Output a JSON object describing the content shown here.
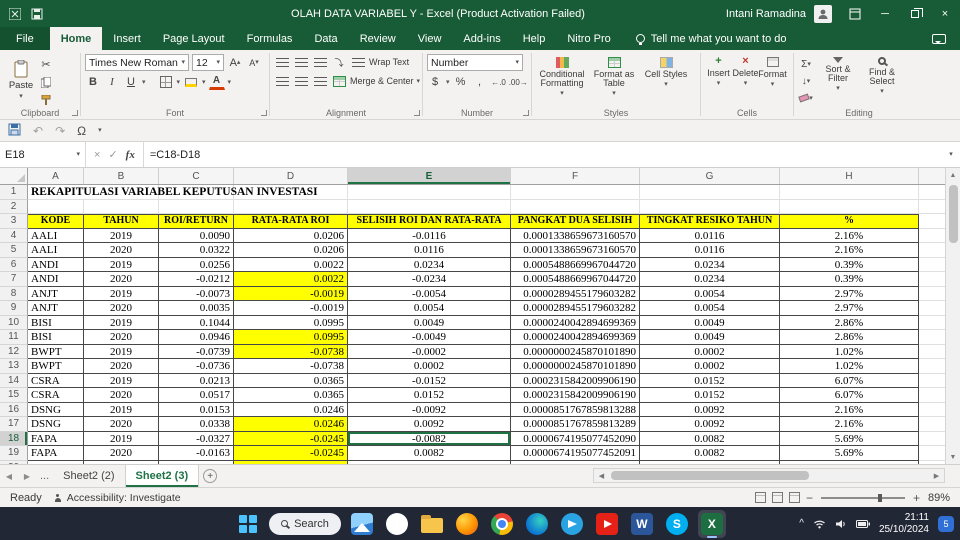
{
  "titlebar": {
    "title": "OLAH DATA VARIABEL Y - Excel (Product Activation Failed)",
    "user": "Intani Ramadina"
  },
  "tabbar": {
    "file": "File",
    "tabs": [
      "Home",
      "Insert",
      "Page Layout",
      "Formulas",
      "Data",
      "Review",
      "View",
      "Add-ins",
      "Help",
      "Nitro Pro"
    ],
    "active": "Home",
    "tellme": "Tell me what you want to do"
  },
  "ribbon": {
    "groups": [
      "Clipboard",
      "Font",
      "Alignment",
      "Number",
      "Styles",
      "Cells",
      "Editing"
    ],
    "paste": "Paste",
    "font_name": "Times New Roman",
    "font_size": "12",
    "wrap_text": "Wrap Text",
    "merge_center": "Merge & Center",
    "number_format": "Number",
    "conditional": "Conditional Formatting",
    "format_table": "Format as Table",
    "cell_styles": "Cell Styles",
    "insert": "Insert",
    "delete": "Delete",
    "format": "Format",
    "sort_filter": "Sort & Filter",
    "find_select": "Find & Select"
  },
  "icons": {
    "caret": "▾",
    "undo": "↶",
    "redo": "↷",
    "omega": "Ω",
    "sigma": "Σ",
    "bold": "B",
    "italic": "I",
    "underline": "U",
    "grow_font": "A",
    "shrink_font": "A",
    "font_color_a": "A",
    "dollar": "$",
    "percent": "%",
    "comma": ",",
    "inc_decimal": "←.0",
    "dec_decimal": ".00→",
    "cancel": "×",
    "check": "✓",
    "fx": "fx",
    "fill_down": "↓",
    "minimize": "─",
    "close": "×",
    "chevron_up": "^",
    "prev": "◀",
    "next": "▶",
    "add": "+",
    "minus": "−",
    "plus": "+",
    "scroll_up": "▲",
    "scroll_down": "▼",
    "word_w": "W",
    "skype_s": "S",
    "excel_x": "X"
  },
  "formulabar": {
    "name_box": "E18",
    "formula": "=C18-D18"
  },
  "sheet": {
    "title": "REKAPITULASI VARIABEL KEPUTUSAN INVESTASI",
    "columns": [
      "A",
      "B",
      "C",
      "D",
      "E",
      "F",
      "G",
      "H"
    ],
    "headers": [
      "KODE",
      "TAHUN",
      "ROI/RETURN",
      "RATA-RATA ROI",
      "SELISIH ROI DAN RATA-RATA",
      "PANGKAT DUA SELISIH",
      "TINGKAT RESIKO TAHUN",
      "%"
    ],
    "active": {
      "row": 18,
      "col": "E"
    },
    "rows": [
      {
        "n": 4,
        "c": [
          "AALI",
          "2019",
          "0.0090",
          "0.0206",
          "-0.0116",
          "0.0001338659673160570",
          "0.0116",
          "2.16%"
        ],
        "y": false
      },
      {
        "n": 5,
        "c": [
          "AALI",
          "2020",
          "0.0322",
          "0.0206",
          "0.0116",
          "0.0001338659673160570",
          "0.0116",
          "2.16%"
        ],
        "y": false
      },
      {
        "n": 6,
        "c": [
          "ANDI",
          "2019",
          "0.0256",
          "0.0022",
          "0.0234",
          "0.0005488669967044720",
          "0.0234",
          "0.39%"
        ],
        "y": false
      },
      {
        "n": 7,
        "c": [
          "ANDI",
          "2020",
          "-0.0212",
          "0.0022",
          "-0.0234",
          "0.0005488669967044720",
          "0.0234",
          "0.39%"
        ],
        "y": true
      },
      {
        "n": 8,
        "c": [
          "ANJT",
          "2019",
          "-0.0073",
          "-0.0019",
          "-0.0054",
          "0.0000289455179603282",
          "0.0054",
          "2.97%"
        ],
        "y": true
      },
      {
        "n": 9,
        "c": [
          "ANJT",
          "2020",
          "0.0035",
          "-0.0019",
          "0.0054",
          "0.0000289455179603282",
          "0.0054",
          "2.97%"
        ],
        "y": false
      },
      {
        "n": 10,
        "c": [
          "BISI",
          "2019",
          "0.1044",
          "0.0995",
          "0.0049",
          "0.0000240042894699369",
          "0.0049",
          "2.86%"
        ],
        "y": false
      },
      {
        "n": 11,
        "c": [
          "BISI",
          "2020",
          "0.0946",
          "0.0995",
          "-0.0049",
          "0.0000240042894699369",
          "0.0049",
          "2.86%"
        ],
        "y": true
      },
      {
        "n": 12,
        "c": [
          "BWPT",
          "2019",
          "-0.0739",
          "-0.0738",
          "-0.0002",
          "0.0000000245870101890",
          "0.0002",
          "1.02%"
        ],
        "y": true
      },
      {
        "n": 13,
        "c": [
          "BWPT",
          "2020",
          "-0.0736",
          "-0.0738",
          "0.0002",
          "0.0000000245870101890",
          "0.0002",
          "1.02%"
        ],
        "y": false
      },
      {
        "n": 14,
        "c": [
          "CSRA",
          "2019",
          "0.0213",
          "0.0365",
          "-0.0152",
          "0.0002315842009906190",
          "0.0152",
          "6.07%"
        ],
        "y": false
      },
      {
        "n": 15,
        "c": [
          "CSRA",
          "2020",
          "0.0517",
          "0.0365",
          "0.0152",
          "0.0002315842009906190",
          "0.0152",
          "6.07%"
        ],
        "y": false
      },
      {
        "n": 16,
        "c": [
          "DSNG",
          "2019",
          "0.0153",
          "0.0246",
          "-0.0092",
          "0.0000851767859813288",
          "0.0092",
          "2.16%"
        ],
        "y": false
      },
      {
        "n": 17,
        "c": [
          "DSNG",
          "2020",
          "0.0338",
          "0.0246",
          "0.0092",
          "0.0000851767859813289",
          "0.0092",
          "2.16%"
        ],
        "y": true
      },
      {
        "n": 18,
        "c": [
          "FAPA",
          "2019",
          "-0.0327",
          "-0.0245",
          "-0.0082",
          "0.0000674195077452090",
          "0.0082",
          "5.69%"
        ],
        "y": true
      },
      {
        "n": 19,
        "c": [
          "FAPA",
          "2020",
          "-0.0163",
          "-0.0245",
          "0.0082",
          "0.0000674195077452091",
          "0.0082",
          "5.69%"
        ],
        "y": true
      }
    ]
  },
  "sheettabs": {
    "ellipsis": "...",
    "tabs": [
      "Sheet2 (2)",
      "Sheet2 (3)"
    ],
    "active": "Sheet2 (3)"
  },
  "statusbar": {
    "ready": "Ready",
    "accessibility": "Accessibility: Investigate",
    "zoom": "89%"
  },
  "taskbar": {
    "search": "Search",
    "time": "21:11",
    "date": "25/10/2024",
    "badge": "5"
  }
}
